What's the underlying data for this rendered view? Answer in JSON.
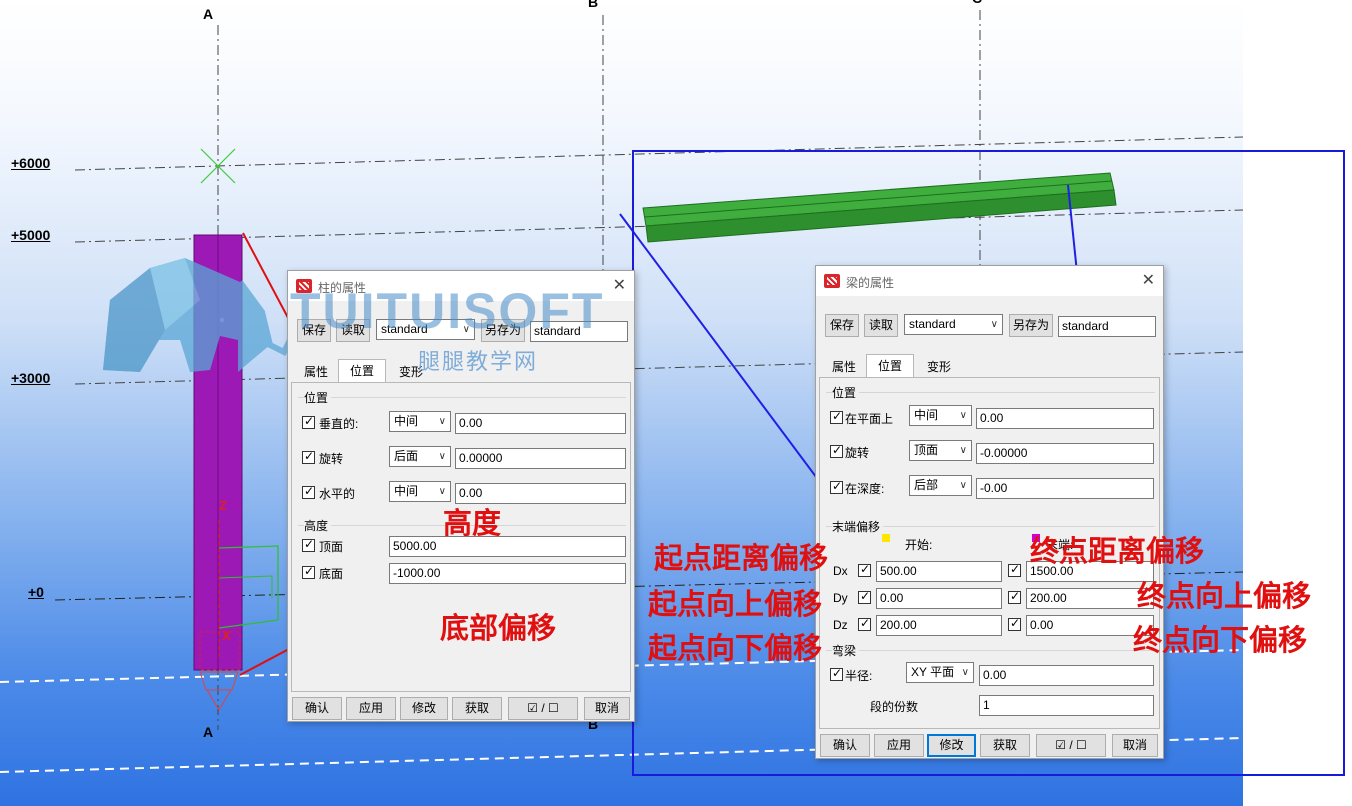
{
  "grid": {
    "a_top": "A",
    "b_top": "B",
    "c_top": "C",
    "a_bottom": "A",
    "b_bottom": "B"
  },
  "levels": [
    {
      "label": "+6000"
    },
    {
      "label": "+5000"
    },
    {
      "label": "+3000"
    },
    {
      "label": "+0"
    }
  ],
  "axis": {
    "z": "Z",
    "x": "X"
  },
  "watermark": {
    "brand": "TUITUISOFT",
    "subtitle": "腿腿教学网"
  },
  "column_dialog": {
    "title": "柱的属性",
    "save": "保存",
    "read": "读取",
    "preset": "standard",
    "save_as": "另存为",
    "save_as_name": "standard",
    "tabs": [
      "属性",
      "位置",
      "变形"
    ],
    "position_group": "位置",
    "rows": [
      {
        "label": "垂直的:",
        "option": "中间",
        "value": "0.00"
      },
      {
        "label": "旋转",
        "option": "后面",
        "value": "0.00000"
      },
      {
        "label": "水平的",
        "option": "中间",
        "value": "0.00"
      }
    ],
    "height_group": "高度",
    "top_label": "顶面",
    "top_value": "5000.00",
    "bottom_label": "底面",
    "bottom_value": "-1000.00",
    "footer": {
      "ok": "确认",
      "apply": "应用",
      "modify": "修改",
      "get": "获取",
      "toggle": "☑ / ☐",
      "cancel": "取消"
    }
  },
  "beam_dialog": {
    "title": "梁的属性",
    "save": "保存",
    "read": "读取",
    "preset": "standard",
    "save_as": "另存为",
    "save_as_name": "standard",
    "tabs": [
      "属性",
      "位置",
      "变形"
    ],
    "position_group": "位置",
    "rows": [
      {
        "label": "在平面上",
        "option": "中间",
        "value": "0.00"
      },
      {
        "label": "旋转",
        "option": "顶面",
        "value": "-0.00000"
      },
      {
        "label": "在深度:",
        "option": "后部",
        "value": "-0.00"
      }
    ],
    "offset_group": "末端偏移",
    "start_label": "开始:",
    "end_label": "末端:",
    "dx_label": "Dx",
    "dy_label": "Dy",
    "dz_label": "Dz",
    "start_dx": "500.00",
    "start_dy": "0.00",
    "start_dz": "200.00",
    "end_dx": "1500.00",
    "end_dy": "200.00",
    "end_dz": "0.00",
    "curve_group": "弯梁",
    "radius_label": "半径:",
    "plane_option": "XY 平面",
    "radius_value": "0.00",
    "segments_label": "段的份数",
    "segments_value": "1",
    "footer": {
      "ok": "确认",
      "apply": "应用",
      "modify": "修改",
      "get": "获取",
      "toggle": "☑ / ☐",
      "cancel": "取消"
    }
  },
  "annotations": {
    "height": "高度",
    "bottom_offset": "底部偏移",
    "start_distance": "起点距离偏移",
    "start_up": "起点向上偏移",
    "start_down": "起点向下偏移",
    "end_distance": "终点距离偏移",
    "end_up": "终点向上偏移",
    "end_down": "终点向下偏移"
  },
  "colors": {
    "column": "#9c19b5",
    "beam": "#2e9b2e",
    "annotation_red": "#e01010",
    "arrow_blue": "#1f1fe6",
    "frame_blue": "#1a1adb"
  }
}
